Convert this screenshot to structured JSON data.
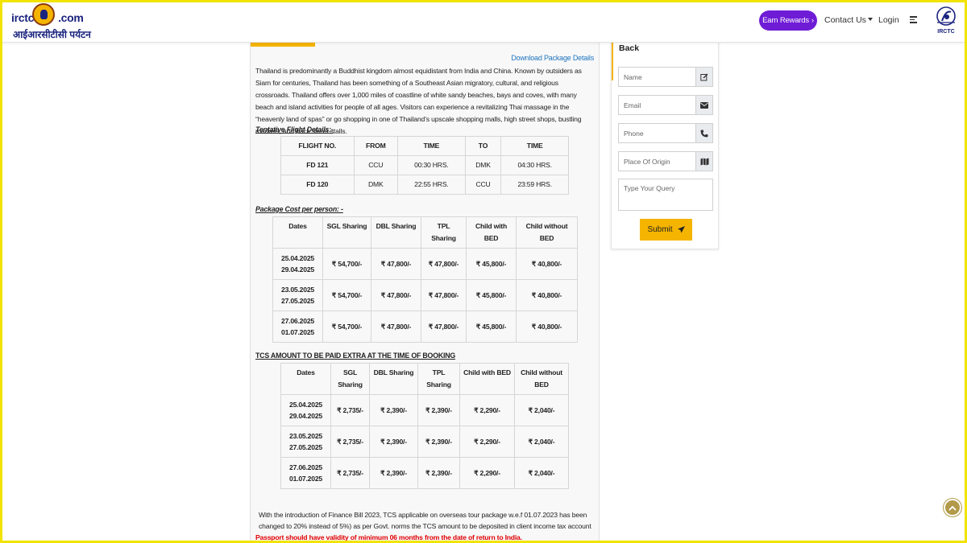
{
  "header": {
    "logo_left": "irctc",
    "logo_right": ".com",
    "logo_hindi": "आईआरसीटीसी पर्यटन",
    "earn_rewards": "Earn Rewards",
    "earn_rewards_chevron": "›",
    "contact_us": "Contact Us",
    "login": "Login",
    "irctc_label": "IRCTC",
    "icons": [
      "irctc-emblem-icon",
      "hamburger-menu-icon",
      "irctc-logo-icon"
    ]
  },
  "content": {
    "download_link": "Download Package Details",
    "description": "Thailand is predominantly a Buddhist kingdom almost equidistant from India and China. Known by outsiders as Siam for centuries, Thailand has been something of a Southeast Asian migratory, cultural, and religious crossroads. Thailand offers over 1,000 miles of coastline of white sandy beaches, bays and coves, with many beach and island activities for people of all ages. Visitors can experience a revitalizing Thai massage in the “heavenly land of spas” or go shopping in one of Thailand’s upscale shopping malls, high street shops, bustling markets, and back street stalls.",
    "flight_title": "Tentative Flight Details:-",
    "flight_headers": [
      "FLIGHT NO.",
      "FROM",
      "TIME",
      "TO",
      "TIME"
    ],
    "flight_rows": [
      [
        "FD 121",
        "CCU",
        "00:30 HRS.",
        "DMK",
        "04:30 HRS."
      ],
      [
        "FD 120",
        "DMK",
        "22:55 HRS.",
        "CCU",
        "23:59 HRS."
      ]
    ],
    "package_title": "Package Cost per person: -",
    "package_headers": [
      "Dates",
      "SGL Sharing",
      "DBL Sharing",
      "TPL Sharing",
      "Child with BED",
      "Child without BED"
    ],
    "package_rows": [
      [
        "25.04.2025 29.04.2025",
        "₹ 54,700/-",
        "₹ 47,800/-",
        "₹ 47,800/-",
        "₹ 45,800/-",
        "₹ 40,800/-"
      ],
      [
        "23.05.2025 27.05.2025",
        "₹ 54,700/-",
        "₹ 47,800/-",
        "₹ 47,800/-",
        "₹ 45,800/-",
        "₹ 40,800/-"
      ],
      [
        "27.06.2025 01.07.2025",
        "₹ 54,700/-",
        "₹ 47,800/-",
        "₹ 47,800/-",
        "₹ 45,800/-",
        "₹ 40,800/-"
      ]
    ],
    "tcs_title": "TCS AMOUNT TO BE PAID EXTRA AT THE TIME OF BOOKING",
    "tcs_headers": [
      "Dates",
      "SGL Sharing",
      "DBL Sharing",
      "TPL Sharing",
      "Child with BED",
      "Child without BED"
    ],
    "tcs_rows": [
      [
        "25.04.2025 29.04.2025",
        "₹ 2,735/-",
        "₹ 2,390/-",
        "₹ 2,390/-",
        "₹ 2,290/-",
        "₹ 2,040/-"
      ],
      [
        "23.05.2025 27.05.2025",
        "₹ 2,735/-",
        "₹ 2,390/-",
        "₹ 2,390/-",
        "₹ 2,290/-",
        "₹ 2,040/-"
      ],
      [
        "27.06.2025 01.07.2025",
        "₹ 2,735/-",
        "₹ 2,390/-",
        "₹ 2,390/-",
        "₹ 2,290/-",
        "₹ 2,040/-"
      ]
    ],
    "finance_note": "With the introduction of Finance Bill 2023, TCS applicable on overseas tour package w.e.f 01.07.2023 has been changed to 20% instead of 5%) as per Govt. norms the TCS amount to be deposited in client income tax account",
    "passport_note": "Passport should have validity of minimum 06 months from the date of return to India."
  },
  "form": {
    "back_label": "Back",
    "name_placeholder": "Name",
    "email_placeholder": "Email",
    "phone_placeholder": "Phone",
    "origin_placeholder": "Place Of Origin",
    "query_placeholder": "Type Your Query",
    "submit_label": "Submit",
    "icons": [
      "edit-icon",
      "envelope-icon",
      "phone-icon",
      "map-icon",
      "paper-plane-icon"
    ]
  },
  "colors": {
    "accent_yellow": "#f5b400",
    "earn_purple": "#6f1cd6",
    "link_blue": "#1e73be",
    "warning_red": "#e00000",
    "frame_yellow": "#f2e300"
  },
  "scroll_top_icon": "chevron-up-icon"
}
